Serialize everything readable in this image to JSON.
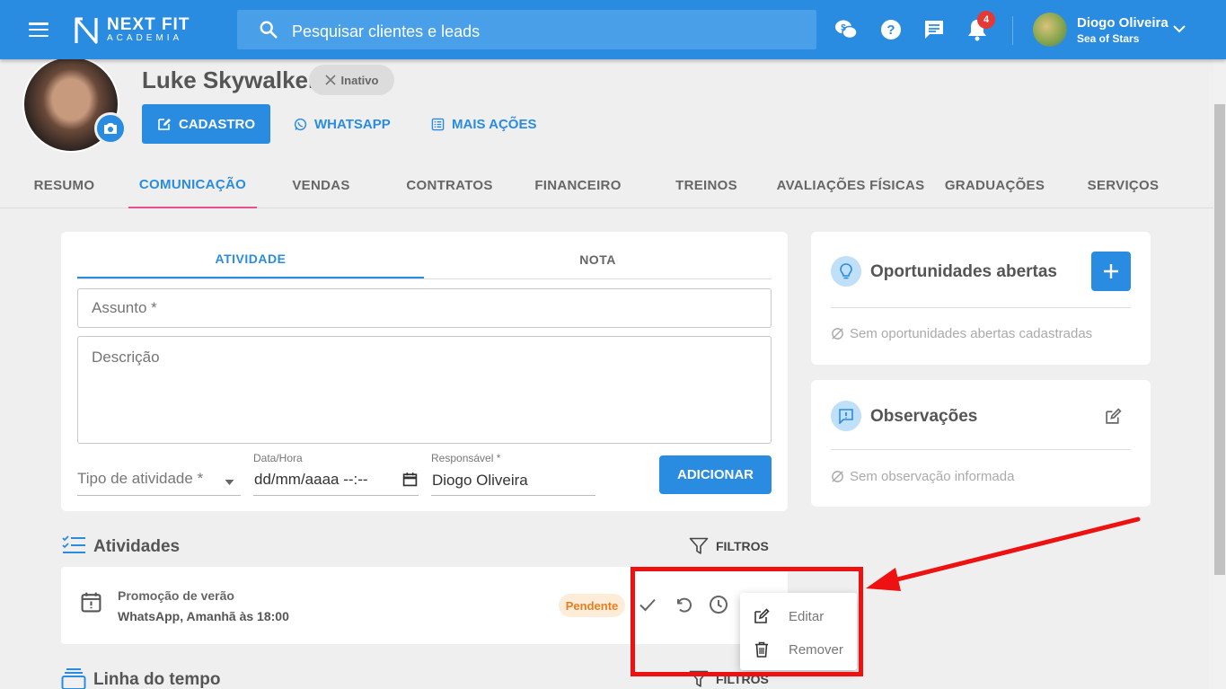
{
  "header": {
    "logo_title": "NEXT FIT",
    "logo_subtitle": "ACADEMIA",
    "search_placeholder": "Pesquisar clientes e leads",
    "notification_count": "4",
    "user_name": "Diogo Oliveira",
    "user_org": "Sea of Stars",
    "brand_color": "#2a8ce0"
  },
  "profile": {
    "name": "Luke Skywalker",
    "status": "Inativo",
    "actions": {
      "cadastro": "CADASTRO",
      "whatsapp": "WHATSAPP",
      "mais_acoes": "MAIS AÇÕES"
    }
  },
  "tabs": [
    "RESUMO",
    "COMUNICAÇÃO",
    "VENDAS",
    "CONTRATOS",
    "FINANCEIRO",
    "TREINOS",
    "AVALIAÇÕES FÍSICAS",
    "GRADUAÇÕES",
    "SERVIÇOS"
  ],
  "active_tab": "COMUNICAÇÃO",
  "form": {
    "subtabs": [
      "ATIVIDADE",
      "NOTA"
    ],
    "assunto_placeholder": "Assunto *",
    "descricao_placeholder": "Descrição",
    "tipo_placeholder": "Tipo de atividade *",
    "datahora_label": "Data/Hora",
    "datahora_value": "dd/mm/aaaa --:--",
    "responsavel_label": "Responsável *",
    "responsavel_value": "Diogo Oliveira",
    "add_button": "ADICIONAR"
  },
  "oportunidades": {
    "title": "Oportunidades abertas",
    "empty": "Sem oportunidades abertas cadastradas"
  },
  "observacoes": {
    "title": "Observações",
    "empty": "Sem observação informada"
  },
  "atividades": {
    "title": "Atividades",
    "filter": "FILTROS",
    "items": [
      {
        "title": "Promoção de verão",
        "subtitle": "WhatsApp, Amanhã às 18:00",
        "status": "Pendente"
      }
    ]
  },
  "context_menu": {
    "edit": "Editar",
    "remove": "Remover"
  },
  "timeline": {
    "title": "Linha do tempo",
    "filter": "FILTROS"
  }
}
